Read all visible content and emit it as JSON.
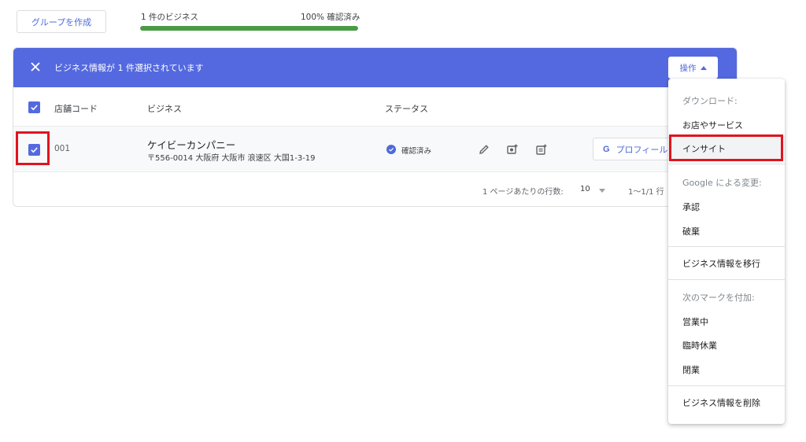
{
  "toolbar": {
    "group_button": "グループを作成",
    "business_count": "1 件のビジネス",
    "verified_percent": "100% 確認済み",
    "progress": 1.0,
    "progress_color": "#4b9a45"
  },
  "selection_bar": {
    "text": "ビジネス情報が 1 件選択されています",
    "ops_button": "操作",
    "color": "#5469df"
  },
  "table": {
    "headers": {
      "code": "店舗コード",
      "business": "ビジネス",
      "status": "ステータス"
    },
    "rows": [
      {
        "code": "001",
        "name": "ケイビーカンパニー",
        "address": "〒556-0014 大阪府 大阪市 浪速区 大国1-3-19",
        "status": "確認済み",
        "profile_button": "プロフィール"
      }
    ],
    "pager": {
      "rows_label": "1 ページあたりの行数:",
      "rows_value": "10",
      "range": "1〜1/1 行"
    }
  },
  "menu": {
    "items": [
      {
        "label": "ダウンロード:",
        "type": "section"
      },
      {
        "label": "お店やサービス",
        "type": "item"
      },
      {
        "label": "インサイト",
        "type": "item",
        "highlighted": true
      },
      {
        "label": "Google による変更:",
        "type": "section"
      },
      {
        "label": "承認",
        "type": "item"
      },
      {
        "label": "破棄",
        "type": "item"
      },
      {
        "label": "ビジネス情報を移行",
        "type": "item"
      },
      {
        "label": "次のマークを付加:",
        "type": "section"
      },
      {
        "label": "営業中",
        "type": "item"
      },
      {
        "label": "臨時休業",
        "type": "item"
      },
      {
        "label": "閉業",
        "type": "item"
      },
      {
        "label": "ビジネス情報を削除",
        "type": "item"
      }
    ]
  },
  "icons": [
    "close-icon",
    "check-icon",
    "verified-icon",
    "edit-icon",
    "add-photo-icon",
    "add-post-icon",
    "google-icon",
    "caret-up-icon",
    "caret-down-icon"
  ],
  "highlight_color": "#e0141e"
}
